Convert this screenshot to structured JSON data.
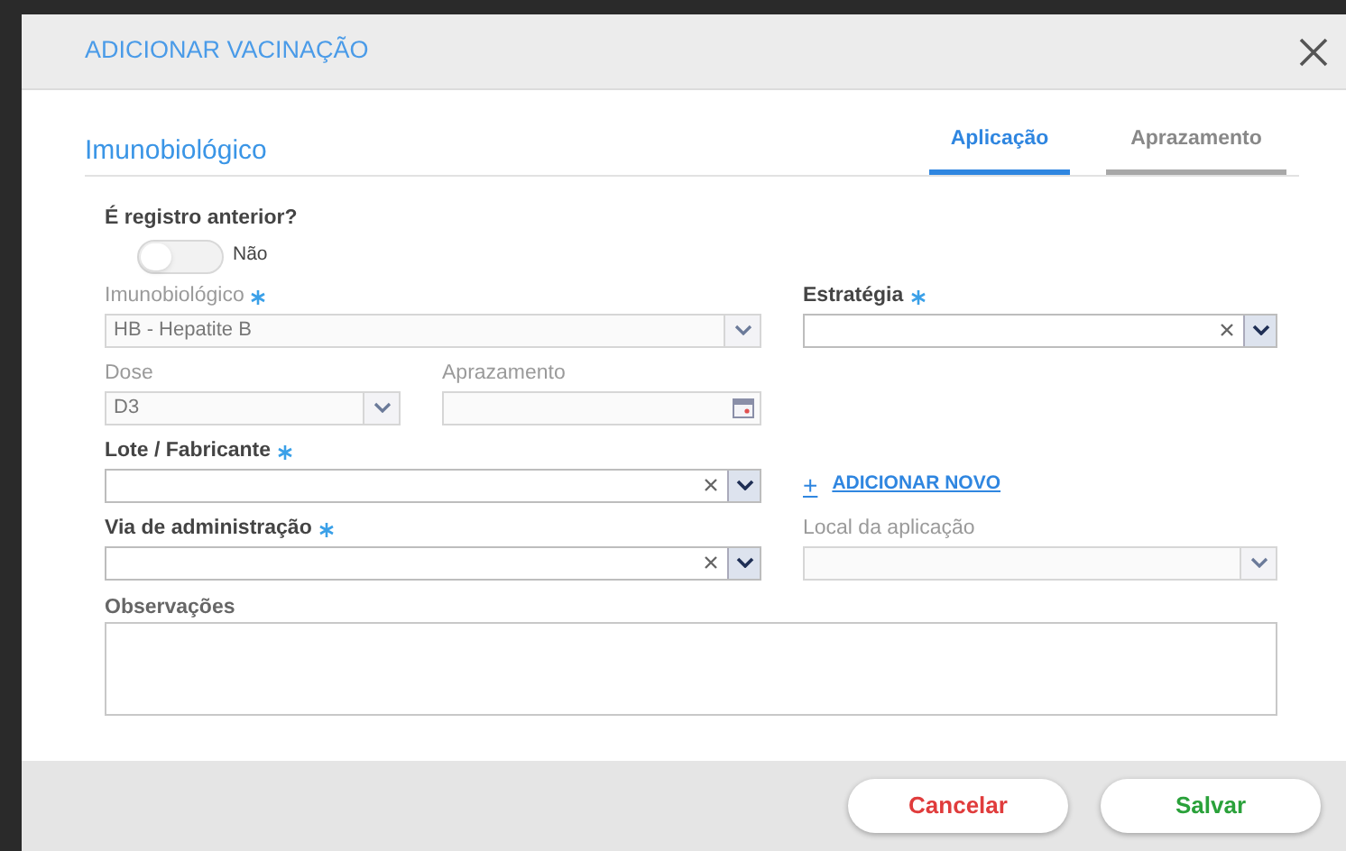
{
  "dialog": {
    "title": "ADICIONAR VACINAÇÃO",
    "section_title": "Imunobiológico",
    "tabs": [
      {
        "label": "Aplicação",
        "selected": true
      },
      {
        "label": "Aprazamento",
        "selected": false
      }
    ],
    "toggle": {
      "label": "É registro anterior?",
      "on": false,
      "state_text": "Não"
    },
    "fields": [
      {
        "label": "Imunobiológico",
        "kind": "select",
        "required": true,
        "disabled": true,
        "value": "HB - Hepatite B"
      },
      {
        "label": "Estratégia",
        "kind": "combo",
        "required": true,
        "disabled": false
      },
      {
        "label": "Dose",
        "kind": "select",
        "required": false,
        "disabled": true,
        "value": "D3"
      },
      {
        "label": "Aprazamento",
        "kind": "date",
        "required": false,
        "disabled": true
      },
      {
        "label": "Lote / Fabricante",
        "kind": "combo",
        "required": true,
        "disabled": false
      },
      {
        "label": "Via de administração",
        "kind": "combo",
        "required": true,
        "disabled": false
      },
      {
        "label": "Local da aplicação",
        "kind": "select",
        "required": false,
        "disabled": true
      }
    ],
    "link": "ADICIONAR NOVO",
    "link_icon": "+",
    "observations": {
      "label": "Observações"
    },
    "buttons": [
      {
        "label": "Cancelar",
        "kind": "cancel"
      },
      {
        "label": "Salvar",
        "kind": "save"
      }
    ]
  }
}
